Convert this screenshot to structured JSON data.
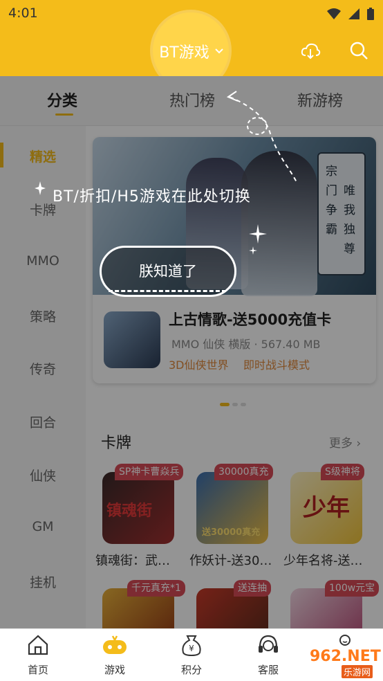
{
  "status_bar": {
    "time": "4:01"
  },
  "app_bar": {
    "title": "BT游戏",
    "dropdown_icon": "chevron-down-icon",
    "cloud_icon": "cloud-download-icon",
    "search_icon": "search-icon"
  },
  "tabs": [
    {
      "label": "分类",
      "active": true
    },
    {
      "label": "热门榜",
      "active": false
    },
    {
      "label": "新游榜",
      "active": false
    }
  ],
  "sidebar": {
    "items": [
      {
        "label": "精选",
        "active": true
      },
      {
        "label": "卡牌"
      },
      {
        "label": "MMO"
      },
      {
        "label": "策略"
      },
      {
        "label": "传奇"
      },
      {
        "label": "回合"
      },
      {
        "label": "仙侠"
      },
      {
        "label": "GM"
      },
      {
        "label": "挂机"
      }
    ]
  },
  "banner": {
    "scroll_text_1": "宗门争霸",
    "scroll_text_2": "唯我独尊",
    "game_name": "上古情歌-送5000充值卡",
    "meta": "MMO 仙侠 横版 · 567.40 MB",
    "tags": [
      "3D仙侠世界",
      "即时战斗模式"
    ]
  },
  "carousel": {
    "active_index": 0,
    "count": 3
  },
  "section": {
    "title": "卡牌",
    "more": "更多"
  },
  "cards": [
    {
      "badge": "SP神卡曹焱兵",
      "art_text": "镇魂街",
      "title": "镇魂街：武…"
    },
    {
      "badge": "30000真充",
      "art_text": "送30000真充",
      "title": "作妖计-送30…"
    },
    {
      "badge": "S级神将",
      "art_text": "少年",
      "title": "少年名将-送…"
    },
    {
      "badge": "千元真充*1",
      "art_text": "",
      "title": ""
    },
    {
      "badge": "送连抽",
      "art_text": "",
      "title": ""
    },
    {
      "badge": "100w元宝",
      "art_text": "",
      "title": ""
    }
  ],
  "guide": {
    "text": "BT/折扣/H5游戏在此处切换",
    "button": "朕知道了"
  },
  "bottom_nav": [
    {
      "label": "首页",
      "icon": "home-icon"
    },
    {
      "label": "游戏",
      "icon": "gamepad-icon",
      "active": true
    },
    {
      "label": "积分",
      "icon": "money-bag-icon"
    },
    {
      "label": "客服",
      "icon": "headset-icon"
    },
    {
      "label": "",
      "icon": "face-icon"
    }
  ],
  "watermark": {
    "brand": "962.NET",
    "sub": "乐游网"
  },
  "colors": {
    "brand": "#f4bc1a",
    "badge": "#d84b57",
    "tag": "#e0893c"
  }
}
